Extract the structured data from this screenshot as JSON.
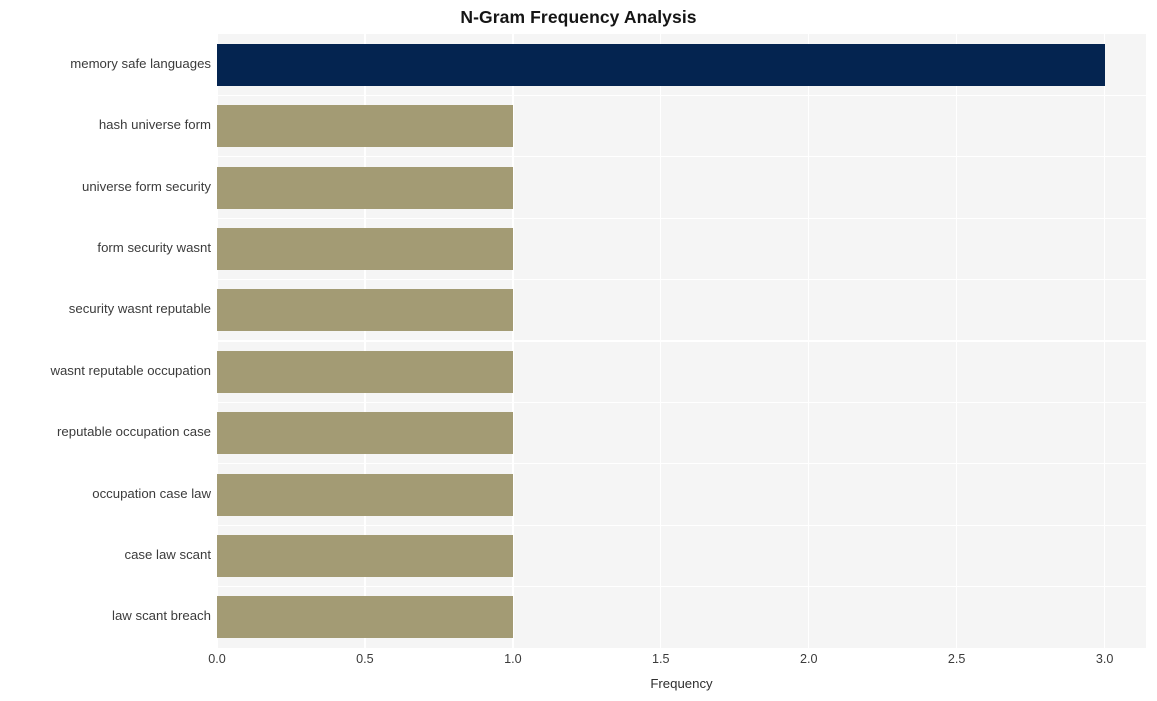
{
  "chart_data": {
    "type": "bar",
    "orientation": "horizontal",
    "title": "N-Gram Frequency Analysis",
    "xlabel": "Frequency",
    "ylabel": "",
    "categories": [
      "memory safe languages",
      "hash universe form",
      "universe form security",
      "form security wasnt",
      "security wasnt reputable",
      "wasnt reputable occupation",
      "reputable occupation case",
      "occupation case law",
      "case law scant",
      "law scant breach"
    ],
    "values": [
      3.0,
      1.0,
      1.0,
      1.0,
      1.0,
      1.0,
      1.0,
      1.0,
      1.0,
      1.0
    ],
    "bar_colors": [
      "#042450",
      "#a39b74",
      "#a39b74",
      "#a39b74",
      "#a39b74",
      "#a39b74",
      "#a39b74",
      "#a39b74",
      "#a39b74",
      "#a39b74"
    ],
    "xlim": [
      0.0,
      3.14
    ],
    "xticks": [
      0.0,
      0.5,
      1.0,
      1.5,
      2.0,
      2.5,
      3.0
    ],
    "xticklabels": [
      "0.0",
      "0.5",
      "1.0",
      "1.5",
      "2.0",
      "2.5",
      "3.0"
    ],
    "grid": true,
    "grid_color": "#ffffff",
    "plot_background": "#f5f5f5",
    "figure_background": "#ffffff",
    "legend": null,
    "legend_position": "none"
  }
}
